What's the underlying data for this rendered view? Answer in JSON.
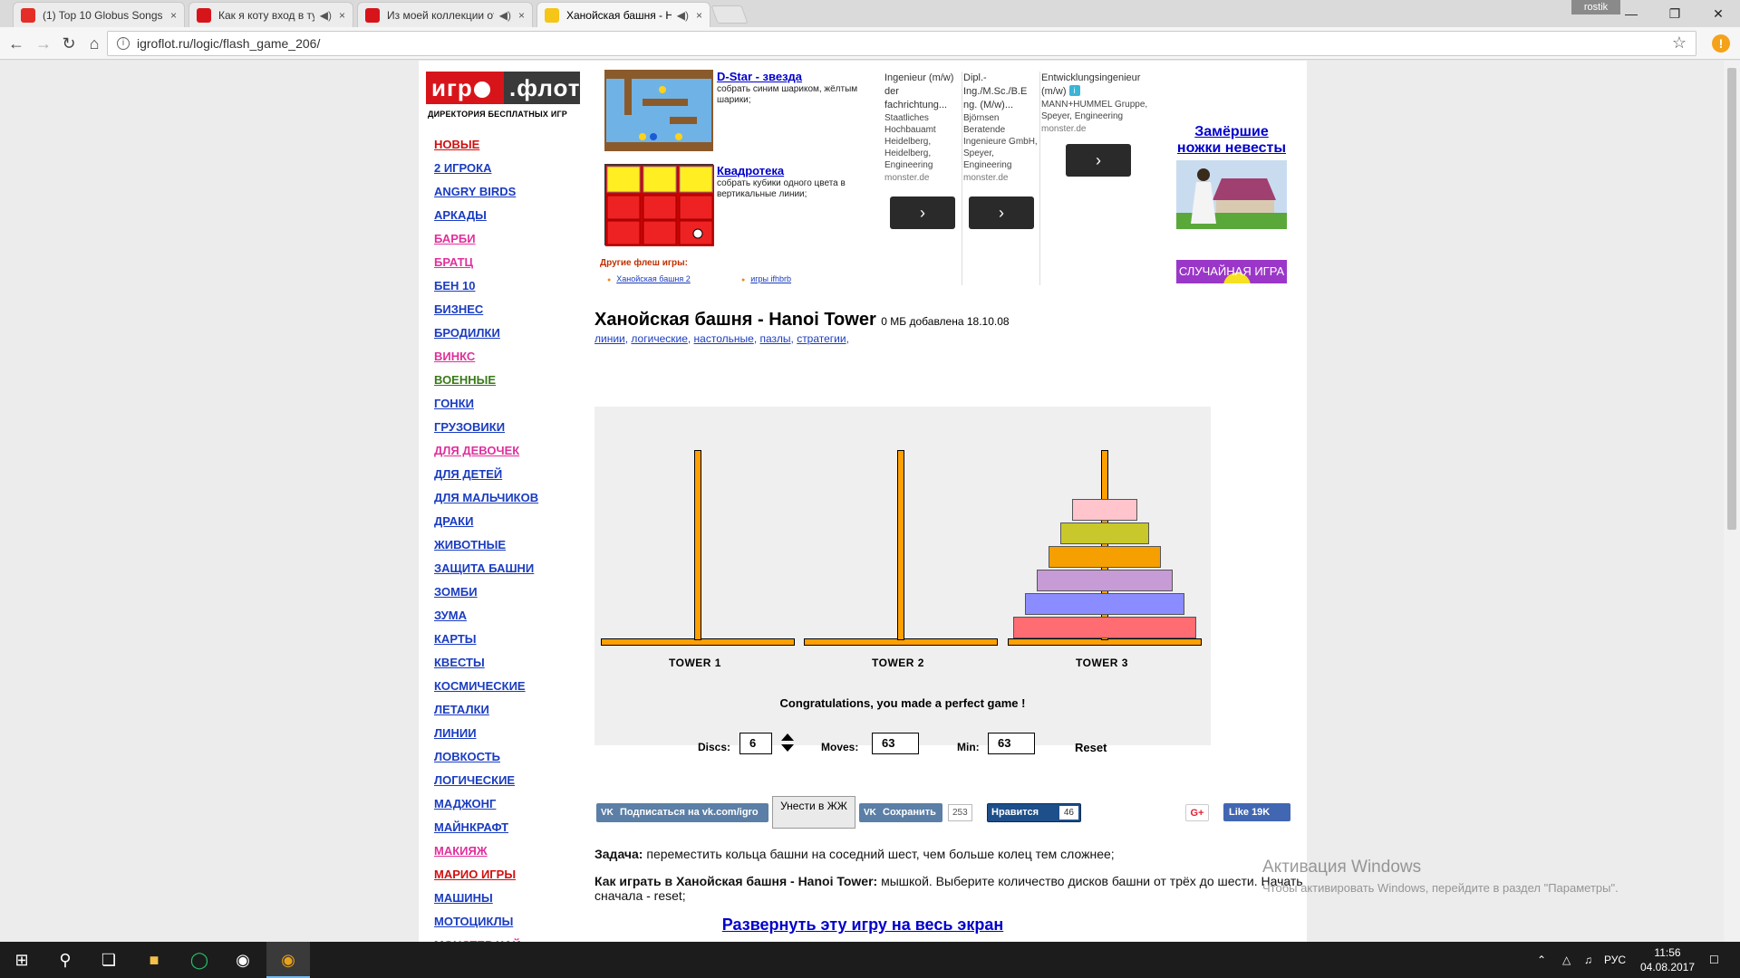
{
  "browser": {
    "tabs": [
      {
        "title": "(1) Top 10 Globus Songs",
        "favicon_color": "#e52d27",
        "audio": false
      },
      {
        "title": "Как я коту вход в туа",
        "favicon_color": "#d8141b",
        "audio": true
      },
      {
        "title": "Из моей коллекции отв",
        "favicon_color": "#d8141b",
        "audio": true
      },
      {
        "title": "Ханойская башня - Н",
        "favicon_color": "#f5c518",
        "audio": true
      }
    ],
    "user_badge": "rostik",
    "url": "igroflot.ru/logic/flash_game_206/",
    "info_glyph": "i",
    "close_glyph": "×",
    "audio_glyph": "◀)",
    "alert_glyph": "!"
  },
  "site": {
    "logo_text_left": "игр",
    "logo_text_right": ".флот",
    "logo_subtitle": "ДИРЕКТОРИЯ БЕСПЛАТНЫХ ИГР",
    "menu": [
      {
        "label": "НОВЫЕ",
        "color": "#d01010"
      },
      {
        "label": "2 ИГРОКА",
        "color": "#1a3cc0"
      },
      {
        "label": "ANGRY BIRDS",
        "color": "#1a3cc0"
      },
      {
        "label": "АРКАДЫ",
        "color": "#1a3cc0"
      },
      {
        "label": "БАРБИ",
        "color": "#e0309c"
      },
      {
        "label": "БРАТЦ",
        "color": "#e0309c"
      },
      {
        "label": "БЕН 10",
        "color": "#1a3cc0"
      },
      {
        "label": "БИЗНЕС",
        "color": "#1a3cc0"
      },
      {
        "label": "БРОДИЛКИ",
        "color": "#1a3cc0"
      },
      {
        "label": "ВИНКС",
        "color": "#e0309c"
      },
      {
        "label": "ВОЕННЫЕ",
        "color": "#3a7a1a"
      },
      {
        "label": "ГОНКИ",
        "color": "#1a3cc0"
      },
      {
        "label": "ГРУЗОВИКИ",
        "color": "#1a3cc0"
      },
      {
        "label": "ДЛЯ ДЕВОЧЕК",
        "color": "#e0309c"
      },
      {
        "label": "ДЛЯ ДЕТЕЙ",
        "color": "#1a3cc0"
      },
      {
        "label": "ДЛЯ МАЛЬЧИКОВ",
        "color": "#1a3cc0"
      },
      {
        "label": "ДРАКИ",
        "color": "#1a3cc0"
      },
      {
        "label": "ЖИВОТНЫЕ",
        "color": "#1a3cc0"
      },
      {
        "label": "ЗАЩИТА БАШНИ",
        "color": "#1a3cc0"
      },
      {
        "label": "ЗОМБИ",
        "color": "#1a3cc0"
      },
      {
        "label": "ЗУМА",
        "color": "#1a3cc0"
      },
      {
        "label": "КАРТЫ",
        "color": "#1a3cc0"
      },
      {
        "label": "КВЕСТЫ",
        "color": "#1a3cc0"
      },
      {
        "label": "КОСМИЧЕСКИЕ",
        "color": "#1a3cc0"
      },
      {
        "label": "ЛЕТАЛКИ",
        "color": "#1a3cc0"
      },
      {
        "label": "ЛИНИИ",
        "color": "#1a3cc0"
      },
      {
        "label": "ЛОВКОСТЬ",
        "color": "#1a3cc0"
      },
      {
        "label": "ЛОГИЧЕСКИЕ",
        "color": "#1a3cc0"
      },
      {
        "label": "МАДЖОНГ",
        "color": "#1a3cc0"
      },
      {
        "label": "МАЙНКРАФТ",
        "color": "#1a3cc0"
      },
      {
        "label": "МАКИЯЖ",
        "color": "#e0309c"
      },
      {
        "label": "МАРИО ИГРЫ",
        "color": "#d01010"
      },
      {
        "label": "МАШИНЫ",
        "color": "#1a3cc0"
      },
      {
        "label": "МОТОЦИКЛЫ",
        "color": "#1a3cc0"
      },
      {
        "label": "МОНСТЕР ХАЙ",
        "color": "#e0309c"
      }
    ]
  },
  "ads": {
    "game1": {
      "title": "D-Star - звезда",
      "desc": "собрать синим шариком, жёлтым шарики;"
    },
    "game2": {
      "title": "Квадротека",
      "desc": "собрать кубики одного цвета в вертикальные линии;"
    },
    "other_label": "Другие флеш игры:",
    "other_links": [
      "Ханойская башня 2",
      "игры ifhbrb"
    ],
    "jobs": [
      {
        "title": "Ingenieur (m/w) der fachrichtung...",
        "company": "Staatliches Hochbauamt Heidelberg, Heidelberg, Engineering",
        "source": "monster.de"
      },
      {
        "title": "Dipl.-Ing./M.Sc./B.E ng. (M/w)...",
        "company": "Björnsen Beratende Ingenieure GmbH, Speyer, Engineering",
        "source": "monster.de"
      },
      {
        "title": "Entwicklungsingenieur (m/w)",
        "company": "MANN+HUMMEL Gruppe, Speyer, Engineering",
        "source": "monster.de"
      }
    ],
    "job_button_glyph": "›",
    "info_glyph": "i",
    "side_title": "Замёршие ножки невесты",
    "random_label": "СЛУЧАЙНАЯ ИГРА"
  },
  "game": {
    "title": "Ханойская башня - Hanoi Tower",
    "meta": "0 МБ добавлена 18.10.08",
    "tags": [
      "линии",
      "логические",
      "настольные",
      "пазлы",
      "стратегии"
    ],
    "towers": [
      "TOWER 1",
      "TOWER 2",
      "TOWER 3"
    ],
    "discs_on_tower": 3,
    "disc_colors": [
      "#ff6d73",
      "#8b8cff",
      "#c79bd6",
      "#f5a000",
      "#c8c82c",
      "#ffc4cc"
    ],
    "message": "Congratulations, you made a perfect game !",
    "discs_label": "Discs:",
    "discs_value": "6",
    "moves_label": "Moves:",
    "moves_value": "63",
    "min_label": "Min:",
    "min_value": "63",
    "reset_label": "Reset"
  },
  "social": {
    "vk_subscribe": "Подписаться на vk.com/igro",
    "lj_label": "Унести в ЖЖ",
    "vk_save": "Сохранить",
    "vk_save_count": "253",
    "nravitsya": "Нравится",
    "nravitsya_count": "46",
    "gplus": "G+",
    "fb_like": "Like 19K"
  },
  "text": {
    "task_label": "Задача:",
    "task": " переместить кольца башни на соседний шест, чем больше колец тем сложнее;",
    "howto_label": "Как играть в Ханойская башня - Hanoi Tower:",
    "howto": " мышкой. Выберите количество дисков башни от трёх до шести. Начать сначала - reset;",
    "fullscreen": "Развернуть эту игру на весь экран"
  },
  "windows": {
    "activation_title": "Активация Windows",
    "activation_sub": "Чтобы активировать Windows, перейдите в раздел \"Параметры\".",
    "lang": "РУС",
    "time": "11:56",
    "date": "04.08.2017"
  }
}
